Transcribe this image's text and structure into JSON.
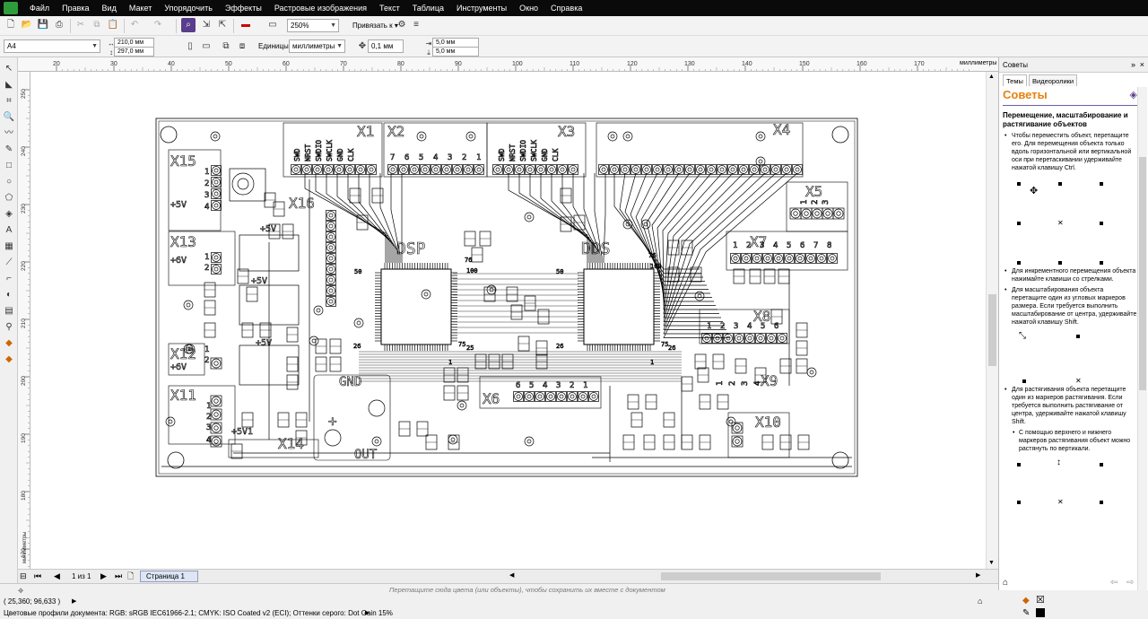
{
  "menu": [
    "Файл",
    "Правка",
    "Вид",
    "Макет",
    "Упорядочить",
    "Эффекты",
    "Растровые изображения",
    "Текст",
    "Таблица",
    "Инструменты",
    "Окно",
    "Справка"
  ],
  "toolbar": {
    "zoom": "250%",
    "snap_label": "Привязать к"
  },
  "propbar": {
    "page_size": "A4",
    "width": "210,0 мм",
    "height": "297,0 мм",
    "units_label": "Единицы:",
    "units_value": "миллиметры",
    "nudge": "0,1 мм",
    "dup_x": "5,0 мм",
    "dup_y": "5,0 мм"
  },
  "ruler": {
    "h_ticks": [
      "20",
      "30",
      "40",
      "50",
      "60",
      "70",
      "80",
      "90",
      "100",
      "110",
      "120",
      "130",
      "140",
      "150",
      "160",
      "170"
    ],
    "unit": "миллиметры",
    "v_ticks": [
      "250",
      "240",
      "230",
      "220",
      "210",
      "200",
      "190",
      "180",
      "170"
    ],
    "v_unit": "миллиметры"
  },
  "pcb": {
    "labels": [
      "X15",
      "X16",
      "X13",
      "X12",
      "X11",
      "X14",
      "X1",
      "X2",
      "X3",
      "X4",
      "X5",
      "X6",
      "X7",
      "X8",
      "X9",
      "X10",
      "DSP",
      "DDS",
      "GND",
      "OUT",
      "+5V",
      "+5V",
      "+5V",
      "+5V",
      "+6V",
      "+6V",
      "+5V1",
      "SWD",
      "NRST",
      "SWDIO",
      "SWCLK",
      "GND",
      "CLK",
      "73",
      "51",
      "50",
      "76",
      "100",
      "26",
      "25",
      "1",
      "75",
      "26"
    ],
    "pins_x2": [
      "7",
      "6",
      "5",
      "4",
      "3",
      "2",
      "1"
    ],
    "pins_x5": [
      "1",
      "2",
      "3"
    ],
    "pins_x7": [
      "1",
      "2",
      "3",
      "4",
      "5",
      "6",
      "7",
      "8"
    ],
    "pins_x6": [
      "6",
      "5",
      "4",
      "3",
      "2",
      "1"
    ],
    "pins_x15": [
      "1",
      "2",
      "3",
      "4"
    ],
    "pins_x8": [
      "1",
      "2",
      "3",
      "4",
      "5",
      "6"
    ],
    "pins_x9": [
      "1",
      "2",
      "3",
      "4"
    ]
  },
  "bottom": {
    "page_counter": "1 из 1",
    "page_tab": "Страница 1",
    "drag_hint": "Перетащите сюда цвета (или объекты), чтобы сохранить их вместе с документом"
  },
  "status": {
    "coords": "( 25,360; 96,633 )",
    "color_profiles": "Цветовые профили документа: RGB: sRGB IEC61966-2.1; CMYK: ISO Coated v2 (ECI); Оттенки серого: Dot Gain 15%"
  },
  "docker": {
    "title": "Советы",
    "tabs": [
      "Темы",
      "Видеоролики"
    ],
    "heading": "Советы",
    "subheading": "Перемещение, масштабирование и растягивание объектов",
    "tip1": "Чтобы переместить объект, перетащите его. Для перемещения объекта только вдоль горизонтальной или вертикальной оси при перетаскивании удерживайте нажатой клавишу Ctrl.",
    "tip2": "Для инкрементного перемещения объекта нажимайте клавиши со стрелками.",
    "tip3": "Для масштабирования объекта перетащите один из угловых маркеров размера. Если требуется выполнить масштабирование от центра, удерживайте нажатой клавишу Shift.",
    "tip4": "Для растягивания объекта перетащите один из маркеров растягивания. Если требуется выполнить растягивание от центра, удерживайте нажатой клавишу Shift.",
    "tip5": "С помощью верхнего и нижнего маркеров растягивания объект можно растянуть по вертикали."
  }
}
